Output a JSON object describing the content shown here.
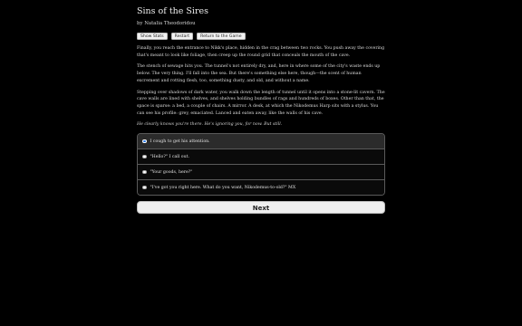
{
  "game": {
    "title": "Sins of the Sires",
    "byline": "by Natalia Theodoridou"
  },
  "toolbar": {
    "show_stats": "Show Stats",
    "restart": "Restart",
    "return_to_game": "Return to the Game"
  },
  "story": {
    "paragraphs": [
      "Finally, you reach the entrance to Nikk's place, hidden in the crag between two rocks. You push away the covering that's meant to look like foliage, then creep up the round grid that conceals the mouth of the cave.",
      "The stench of sewage hits you. The tunnel's not entirely dry, and, here in where some of the city's waste ends up below. The very thing. I'll fall into the sea. But there's something else here, though—the scent of human excrement and rotting flesh, too, something dusty, and old, and without a name.",
      "Stepping over shadows of dark water, you walk down the length of tunnel until it opens into a stone-lit cavern. The cave walls are lined with shelves, and shelves holding bundles of rags and hundreds of boxes. Other than that, the space is sparse: a bed, a couple of chairs. A mirror. A desk, at which the Nikodemus Harp sits with a stylus. You can see his profile: grey, emaciated. Lanced and eaten away, like the walls of his cave."
    ],
    "prompt": "He clearly knows you're there. He's ignoring you, for now. But still."
  },
  "choices": [
    {
      "label": "I cough to get his attention.",
      "selected": true
    },
    {
      "label": "\"Hello?\" I call out.",
      "selected": false
    },
    {
      "label": "\"Your goods, here?\"",
      "selected": false
    },
    {
      "label": "\"I've got you right here. What do you want, Nikodemus-to-old?\" MX",
      "selected": false
    }
  ],
  "next_label": "Next",
  "colors": {
    "background": "#000000",
    "text": "#dadada",
    "selected_choice": "#2b2b2b",
    "radio_checked": "#2c7be5",
    "button": "#efefef"
  }
}
